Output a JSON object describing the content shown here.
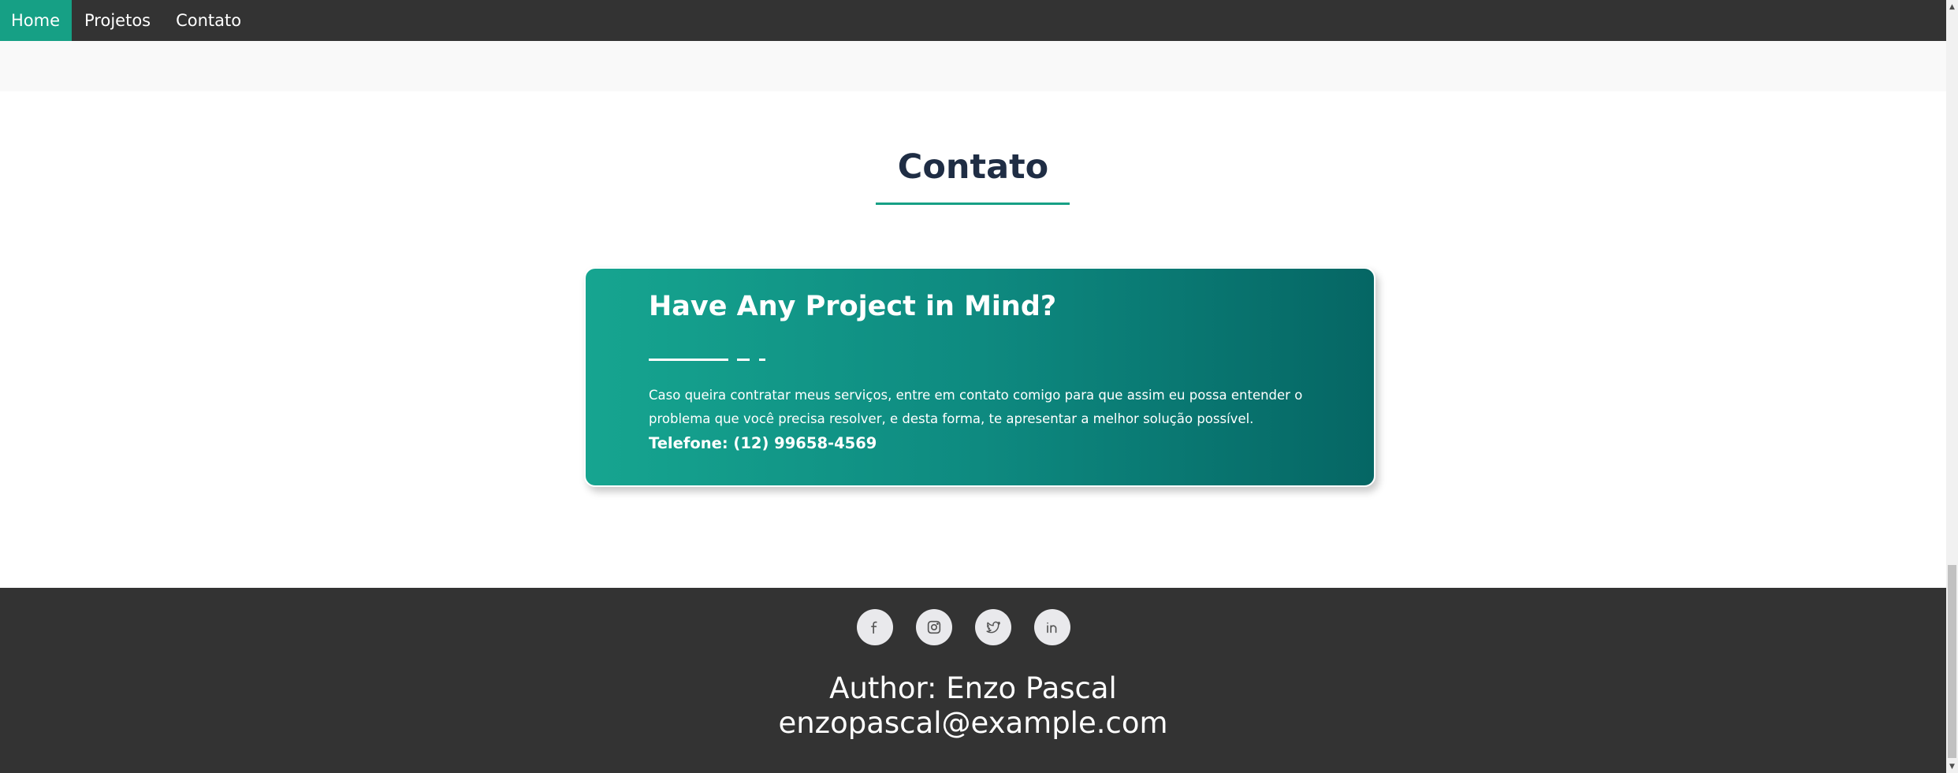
{
  "nav": {
    "items": [
      {
        "label": "Home",
        "active": true
      },
      {
        "label": "Projetos",
        "active": false
      },
      {
        "label": "Contato",
        "active": false
      }
    ]
  },
  "section": {
    "title": "Contato"
  },
  "card": {
    "title": "Have Any Project in Mind?",
    "text_line1": "Caso queira contratar meus serviços, entre em contato comigo para que assim eu possa entender o",
    "text_line2": "problema que você precisa resolver, e desta forma, te apresentar a melhor solução possível.",
    "phone": "Telefone: (12) 99658-4569"
  },
  "footer": {
    "social_icons": [
      "facebook-icon",
      "instagram-icon",
      "twitter-icon",
      "linkedin-icon"
    ],
    "author": "Author: Enzo Pascal",
    "email": "enzopascal@example.com"
  },
  "colors": {
    "accent": "#16a085",
    "dark": "#333333",
    "title": "#1f2d44",
    "card_gradient_start": "#16a590",
    "card_gradient_end": "#056664"
  }
}
